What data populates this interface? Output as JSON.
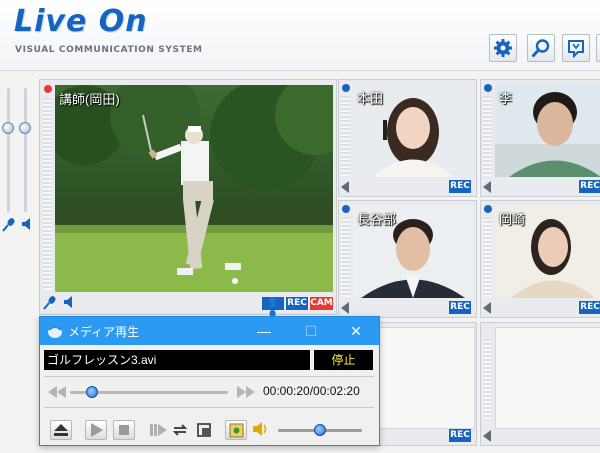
{
  "header": {
    "brand": "Live On",
    "tagline": "VISUAL COMMUNICATION SYSTEM",
    "tools": [
      {
        "icon": "gear-icon"
      },
      {
        "icon": "search-icon"
      },
      {
        "icon": "bookmark-icon"
      }
    ]
  },
  "main_video": {
    "name": "講師(岡田)",
    "tags": {
      "users": "👤👤",
      "rec": "REC",
      "cam": "CAM"
    }
  },
  "participants": [
    {
      "name": "本田",
      "tag": "REC"
    },
    {
      "name": "李",
      "tag": "REC"
    },
    {
      "name": "長谷部",
      "tag": "REC"
    },
    {
      "name": "岡崎",
      "tag": "REC"
    }
  ],
  "empty_slots": [
    {
      "tag": "REC"
    },
    {
      "tag": ""
    }
  ],
  "media_player": {
    "title": "メディア再生",
    "file": "ゴルフレッスン3.avi",
    "status": "停止",
    "time": "00:00:20/00:02:20",
    "progress": 0.14,
    "volume": 0.5,
    "window_buttons": {
      "minimize": "—",
      "maximize": "☐",
      "close": "✕"
    }
  },
  "colors": {
    "brand": "#1565c0",
    "title_bar": "#2b9af3",
    "rec": "#1565c0",
    "cam": "#e53935",
    "status_text": "#ffeb3b"
  }
}
